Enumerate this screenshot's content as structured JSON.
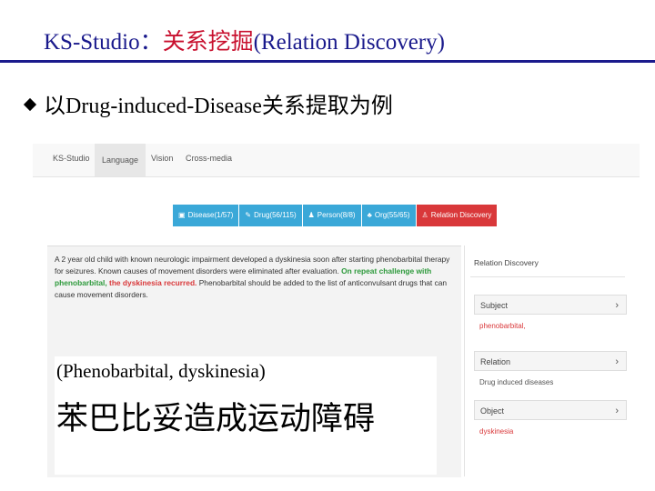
{
  "slide": {
    "title_en": "KS-Studio：",
    "title_cn": "关系挖掘",
    "title_paren": "(Relation Discovery)",
    "bullet": "以Drug-induced-Disease关系提取为例"
  },
  "app": {
    "nav": [
      "KS-Studio",
      "Language",
      "Vision",
      "Cross-media"
    ],
    "tags": [
      {
        "icon": "disease-icon",
        "label": "Disease(1/57)"
      },
      {
        "icon": "drug-icon",
        "label": "Drug(56/115)"
      },
      {
        "icon": "person-icon",
        "label": "Person(8/8)"
      },
      {
        "icon": "org-icon",
        "label": "Org(55/65)"
      },
      {
        "icon": "relation-icon",
        "label": "Relation Discovery"
      }
    ],
    "text": {
      "part1": "A 2 year old child with known neurologic impairment developed a dyskinesia soon after starting phenobarbital therapy for seizures. Known causes of movement disorders were eliminated after evaluation. ",
      "part2_green": "On repeat challenge with phenobarbital,",
      "part3_red": " the dyskinesia recurred.",
      "part4": " Phenobarbital should be added to the list of anticonvulsant drugs that can cause movement disorders."
    },
    "panel": {
      "title": "Relation Discovery",
      "subject_label": "Subject",
      "subject_value": "phenobarbital,",
      "relation_label": "Relation",
      "relation_value": "Drug induced diseases",
      "object_label": "Object",
      "object_value": "dyskinesia"
    }
  },
  "overlay": {
    "en": "(Phenobarbital, dyskinesia)",
    "cn": "苯巴比妥造成运动障碍"
  }
}
